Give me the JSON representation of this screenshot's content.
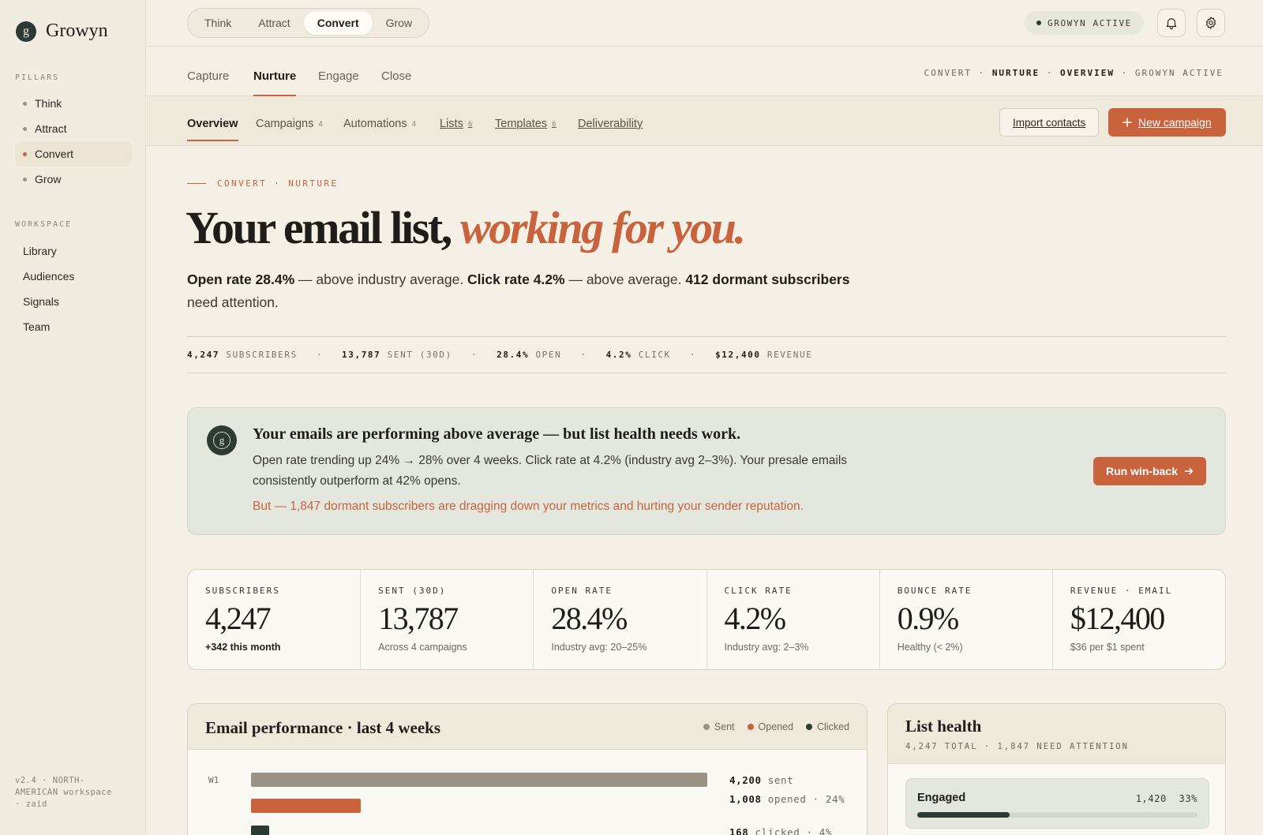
{
  "brand": {
    "mark": "g",
    "name": "Growyn"
  },
  "sidebar": {
    "pillars_label": "PILLARS",
    "pillars": [
      {
        "label": "Think",
        "active": false
      },
      {
        "label": "Attract",
        "active": false
      },
      {
        "label": "Convert",
        "active": true
      },
      {
        "label": "Grow",
        "active": false
      }
    ],
    "workspace_label": "WORKSPACE",
    "workspace": [
      {
        "label": "Library"
      },
      {
        "label": "Audiences"
      },
      {
        "label": "Signals"
      },
      {
        "label": "Team"
      }
    ],
    "footer": "v2.4 · NORTH-AMERICAN workspace · zaid"
  },
  "topbar": {
    "segments": [
      {
        "label": "Think",
        "active": false
      },
      {
        "label": "Attract",
        "active": false
      },
      {
        "label": "Convert",
        "active": true
      },
      {
        "label": "Grow",
        "active": false
      }
    ],
    "status": "GROWYN ACTIVE",
    "icons": [
      "bell-icon",
      "gear-icon"
    ]
  },
  "subnav": {
    "tabs": [
      {
        "label": "Capture",
        "active": false
      },
      {
        "label": "Nurture",
        "active": true
      },
      {
        "label": "Engage",
        "active": false
      },
      {
        "label": "Close",
        "active": false
      }
    ],
    "crumbs": {
      "c1": "CONVERT",
      "c2": "NURTURE",
      "c3": "OVERVIEW",
      "c4": "GROWYN ACTIVE",
      "sep": " · "
    }
  },
  "tabbar": {
    "tabs": [
      {
        "label": "Overview",
        "count": "",
        "active": true
      },
      {
        "label": "Campaigns",
        "count": "4",
        "active": false
      },
      {
        "label": "Automations",
        "count": "4",
        "active": false
      },
      {
        "label": "Lists",
        "count": "6",
        "active": false
      },
      {
        "label": "Templates",
        "count": "6",
        "active": false
      },
      {
        "label": "Deliverability",
        "count": "",
        "active": false
      }
    ],
    "import_label": "Import contacts",
    "new_label": "New campaign",
    "new_icon": "plus-icon"
  },
  "hero": {
    "eyebrow": "CONVERT · NURTURE",
    "headline_plain": "Your email list, ",
    "headline_accent": "working for you.",
    "lede": {
      "p1": "Open rate 28.4%",
      "t1": " — above industry average. ",
      "p2": "Click rate 4.2%",
      "t2": " — above average. ",
      "p3": "412 dormant subscribers",
      "t3": " need attention."
    }
  },
  "strip": [
    {
      "value": "4,247",
      "label": "SUBSCRIBERS"
    },
    {
      "value": "13,787",
      "label": "SENT (30D)"
    },
    {
      "value": "28.4%",
      "label": "OPEN"
    },
    {
      "value": "4.2%",
      "label": "CLICK"
    },
    {
      "value": "$12,400",
      "label": "REVENUE"
    }
  ],
  "insight": {
    "mark": "g",
    "title": "Your emails are performing above average — but list health needs work.",
    "body": "Open rate trending up 24% → 28% over 4 weeks. Click rate at 4.2% (industry avg 2–3%). Your presale emails consistently outperform at 42% opens.",
    "alert": "But — 1,847 dormant subscribers are dragging down your metrics and hurting your sender reputation.",
    "cta": "Run win-back",
    "cta_icon": "arrow-right-icon"
  },
  "kpis": [
    {
      "label": "SUBSCRIBERS",
      "value": "4,247",
      "sub": "+342 this month",
      "strong": true
    },
    {
      "label": "SENT (30D)",
      "value": "13,787",
      "sub": "Across 4 campaigns",
      "strong": false
    },
    {
      "label": "OPEN RATE",
      "value": "28.4%",
      "sub": "Industry avg: 20–25%",
      "strong": false
    },
    {
      "label": "CLICK RATE",
      "value": "4.2%",
      "sub": "Industry avg: 2–3%",
      "strong": false
    },
    {
      "label": "BOUNCE RATE",
      "value": "0.9%",
      "sub": "Healthy (< 2%)",
      "strong": false
    },
    {
      "label": "REVENUE · EMAIL",
      "value": "$12,400",
      "sub": "$36 per $1 spent",
      "strong": false
    }
  ],
  "performance": {
    "title": "Email performance · last 4 weeks",
    "legend": [
      {
        "name": "Sent",
        "color": "#9b9384"
      },
      {
        "name": "Opened",
        "color": "#c8633e"
      },
      {
        "name": "Clicked",
        "color": "#2b3a33"
      }
    ],
    "weeks": [
      {
        "label": "W1",
        "sent": 4200,
        "opened": 1008,
        "clicked": 168,
        "sent_label": {
          "value": "4,200",
          "unit": " sent"
        },
        "opened_label": {
          "value": "1,008",
          "unit": " opened · 24%"
        },
        "clicked_label": {
          "value": "168",
          "unit": " clicked · 4%"
        }
      }
    ]
  },
  "health": {
    "title": "List health",
    "subtitle": "4,247 TOTAL · 1,847 NEED ATTENTION",
    "rows": [
      {
        "name": "Engaged",
        "count": "1,420",
        "pct": "33%",
        "fraction": 0.33
      }
    ]
  }
}
